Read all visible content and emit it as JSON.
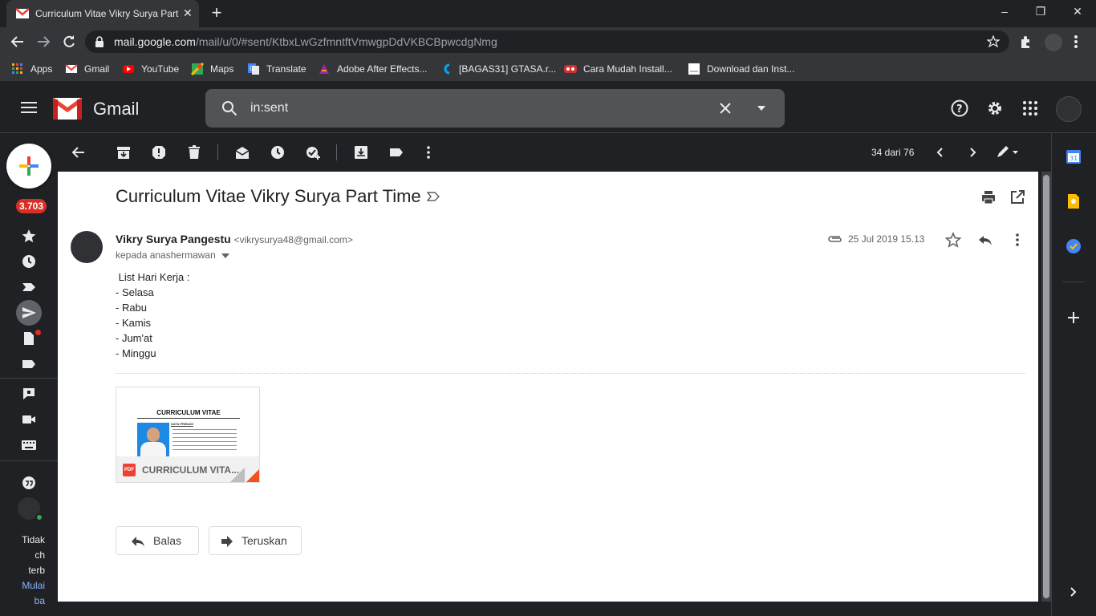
{
  "browser": {
    "tab_title": "Curriculum Vitae Vikry Surya Part",
    "url_host": "mail.google.com",
    "url_path": "/mail/u/0/#sent/KtbxLwGzfmntftVmwgpDdVKBCBpwcdgNmg",
    "bookmarks": [
      {
        "label": "Apps",
        "icon": "apps-grid-icon",
        "color": "#f4b400"
      },
      {
        "label": "Gmail",
        "icon": "gmail-icon",
        "color": "#ea4335"
      },
      {
        "label": "YouTube",
        "icon": "youtube-icon",
        "color": "#ff0000"
      },
      {
        "label": "Maps",
        "icon": "maps-icon",
        "color": "#34a853"
      },
      {
        "label": "Translate",
        "icon": "translate-icon",
        "color": "#4285f4"
      },
      {
        "label": "Adobe After Effects...",
        "icon": "after-effects-icon",
        "color": "#9c27b0"
      },
      {
        "label": "[BAGAS31] GTASA.r...",
        "icon": "bagas31-icon",
        "color": "#00a8e8"
      },
      {
        "label": "Cara Mudah Install...",
        "icon": "site-icon",
        "color": "#d32f2f"
      },
      {
        "label": "Download dan Inst...",
        "icon": "page-icon",
        "color": "#ffffff"
      }
    ]
  },
  "gmail": {
    "logo_text": "Gmail",
    "search_query": "in:sent",
    "unread_badge": "3.703",
    "pager": "34 dari 76",
    "hangouts_text": [
      "Tidak",
      "ch",
      "terb",
      "Mulai",
      "ba"
    ],
    "message": {
      "subject": "Curriculum Vitae Vikry Surya Part Time",
      "sender_name": "Vikry Surya Pangestu",
      "sender_email": "<vikrysurya48@gmail.com>",
      "to_line": "kepada anashermawan",
      "date": "25 Jul 2019 15.13",
      "body_lines": [
        " List Hari Kerja :",
        "- Selasa",
        "- Rabu",
        "- Kamis",
        "- Jum'at",
        "- Minggu"
      ],
      "attachment": {
        "name": "CURRICULUM VITA...",
        "type_badge": "PDF",
        "preview_heading": "CURRICULUM VITAE",
        "preview_section": "DATA PRIBADI"
      },
      "reply_label": "Balas",
      "forward_label": "Teruskan"
    }
  },
  "colors": {
    "chrome_bg": "#202124",
    "chrome_surface": "#35363a",
    "badge_red": "#d93025",
    "content_bg": "#ffffff"
  }
}
